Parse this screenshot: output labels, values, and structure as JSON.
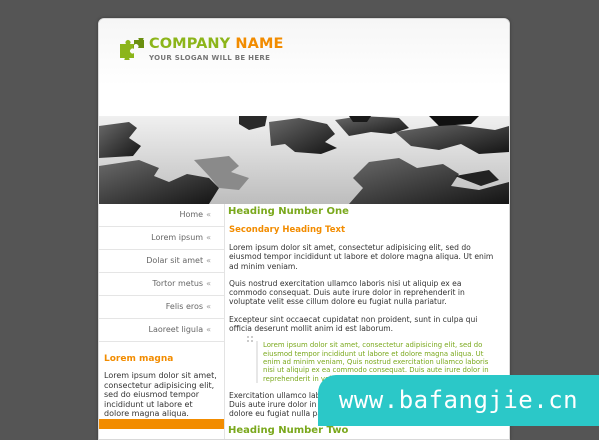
{
  "header": {
    "company_part1": "COMPANY",
    "company_part2": "NAME",
    "slogan": "YOUR SLOGAN WILL BE HERE"
  },
  "nav": {
    "items": [
      {
        "label": "Home"
      },
      {
        "label": "Lorem ipsum"
      },
      {
        "label": "Dolar sit amet"
      },
      {
        "label": "Tortor metus"
      },
      {
        "label": "Felis eros"
      },
      {
        "label": "Laoreet ligula"
      }
    ],
    "arrow": "«"
  },
  "sidebar": {
    "heading": "Lorem magna",
    "text": "Lorem ipsum dolor sit amet, consectetur adipisicing elit, sed do eiusmod tempor incididunt ut labore et dolore magna aliqua."
  },
  "content": {
    "heading1": "Heading Number One",
    "heading2": "Secondary Heading Text",
    "para1": "Lorem ipsum dolor sit amet, consectetur adipisicing elit, sed do eiusmod tempor incididunt ut labore et dolore magna aliqua. Ut enim ad minim veniam.",
    "para2": "Quis nostrud exercitation ullamco laboris nisi ut aliquip ex ea commodo consequat. Duis aute irure dolor in reprehenderit in voluptate velit esse cillum dolore eu fugiat nulla pariatur.",
    "para3": "Excepteur sint occaecat cupidatat non proident, sunt in culpa qui officia deserunt mollit anim id est laborum.",
    "quote": "Lorem ipsum dolor sit amet, consectetur adipisicing elit, sed do eiusmod tempor incididunt ut labore et dolore magna aliqua. Ut enim ad minim veniam, Quis nostrud exercitation ullamco laboris nisi ut aliquip ex ea commodo consequat. Duis aute irure dolor in reprehenderit in voluptate velit esse cillum dolore eu fugiat",
    "para4": "Exercitation ullamco laboris nisi ut aliquip ex ea commodo consequat. Duis aute irure dolor in reprehenderit in voluptate velit esse cillum dolore eu fugiat nulla pariatur.",
    "heading3": "Heading Number Two"
  },
  "watermark": "www.bafangjie.cn",
  "colors": {
    "background": "#555555",
    "green": "#8cb51a",
    "orange": "#f28c00",
    "watermark": "#2bc8c8"
  }
}
